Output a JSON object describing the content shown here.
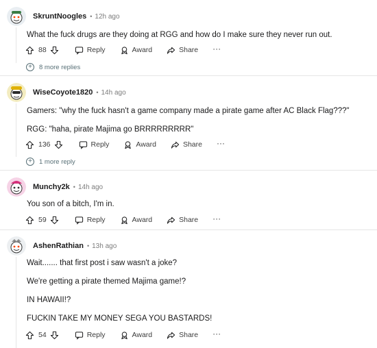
{
  "comments": [
    {
      "username": "SkruntNoogles",
      "time": "12h ago",
      "body": [
        "What the fuck drugs are they doing at RGG and how do I make sure they never run out."
      ],
      "votes": "88",
      "reply_label": "Reply",
      "award_label": "Award",
      "share_label": "Share",
      "more_label": "···",
      "more_replies": "8 more replies"
    },
    {
      "username": "WiseCoyote1820",
      "time": "14h ago",
      "body": [
        "Gamers: \"why the fuck hasn't a game company made a pirate game after AC Black Flag???\"",
        "RGG: \"haha, pirate Majima go BRRRRRRRRR\""
      ],
      "votes": "136",
      "reply_label": "Reply",
      "award_label": "Award",
      "share_label": "Share",
      "more_label": "···",
      "more_replies": "1 more reply"
    },
    {
      "username": "Munchy2k",
      "time": "14h ago",
      "body": [
        "You son of a bitch, I'm in."
      ],
      "votes": "59",
      "reply_label": "Reply",
      "award_label": "Award",
      "share_label": "Share",
      "more_label": "···"
    },
    {
      "username": "AshenRathian",
      "time": "13h ago",
      "body": [
        "Wait....... that first post i saw wasn't a joke?",
        "We're getting a pirate themed Majima game!?",
        "IN HAWAII!?",
        "FUCKIN TAKE MY MONEY SEGA YOU BASTARDS!"
      ],
      "votes": "54",
      "reply_label": "Reply",
      "award_label": "Award",
      "share_label": "Share",
      "more_label": "···"
    }
  ],
  "colors": {
    "text": "#1a1a1b",
    "meta": "#7c7c7c",
    "divider": "#e5e5e5",
    "link": "#576f76"
  },
  "icons": [
    "upvote-icon",
    "downvote-icon",
    "comment-icon",
    "award-icon",
    "share-icon",
    "plus-circle-icon"
  ]
}
